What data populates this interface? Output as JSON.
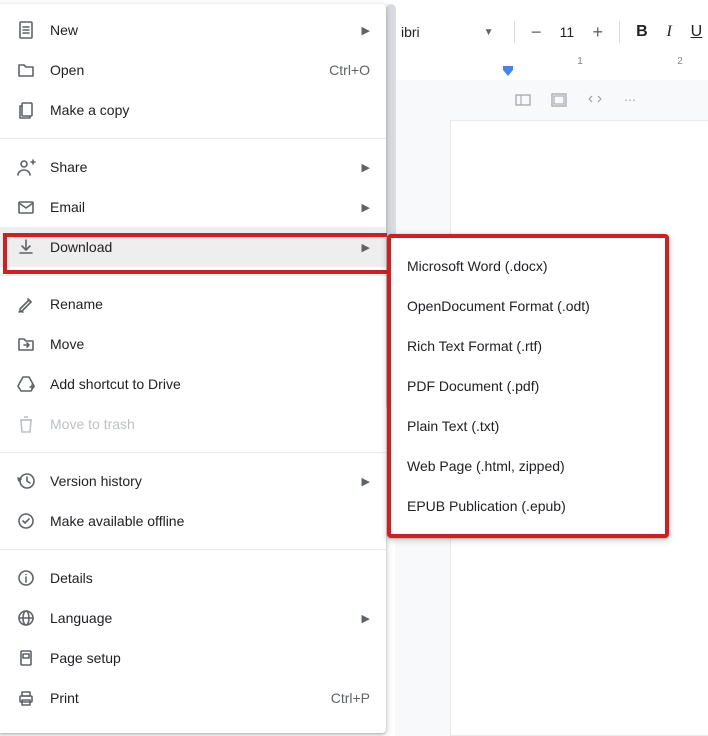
{
  "toolbar": {
    "font_name_partial": "ibri",
    "font_size": "11"
  },
  "ruler": {
    "ticks": [
      "",
      "",
      "1",
      "",
      "2"
    ]
  },
  "file_menu": {
    "groups": [
      [
        {
          "id": "new",
          "label": "New",
          "icon": "file-plus",
          "arrow": true
        },
        {
          "id": "open",
          "label": "Open",
          "icon": "folder",
          "shortcut": "Ctrl+O"
        },
        {
          "id": "make-copy",
          "label": "Make a copy",
          "icon": "copy"
        }
      ],
      [
        {
          "id": "share",
          "label": "Share",
          "icon": "person-plus",
          "arrow": true
        },
        {
          "id": "email",
          "label": "Email",
          "icon": "mail",
          "arrow": true
        },
        {
          "id": "download",
          "label": "Download",
          "icon": "download",
          "arrow": true,
          "highlight": true
        }
      ],
      [
        {
          "id": "rename",
          "label": "Rename",
          "icon": "pencil"
        },
        {
          "id": "move",
          "label": "Move",
          "icon": "move-folder"
        },
        {
          "id": "add-shortcut",
          "label": "Add shortcut to Drive",
          "icon": "drive-shortcut"
        },
        {
          "id": "move-trash",
          "label": "Move to trash",
          "icon": "trash",
          "disabled": true
        }
      ],
      [
        {
          "id": "version-history",
          "label": "Version history",
          "icon": "history",
          "arrow": true
        },
        {
          "id": "make-offline",
          "label": "Make available offline",
          "icon": "offline"
        }
      ],
      [
        {
          "id": "details",
          "label": "Details",
          "icon": "info"
        },
        {
          "id": "language",
          "label": "Language",
          "icon": "globe",
          "arrow": true
        },
        {
          "id": "page-setup",
          "label": "Page setup",
          "icon": "page-setup"
        },
        {
          "id": "print",
          "label": "Print",
          "icon": "print",
          "shortcut": "Ctrl+P"
        }
      ]
    ]
  },
  "download_submenu": {
    "items": [
      "Microsoft Word (.docx)",
      "OpenDocument Format (.odt)",
      "Rich Text Format (.rtf)",
      "PDF Document (.pdf)",
      "Plain Text (.txt)",
      "Web Page (.html, zipped)",
      "EPUB Publication (.epub)"
    ]
  }
}
